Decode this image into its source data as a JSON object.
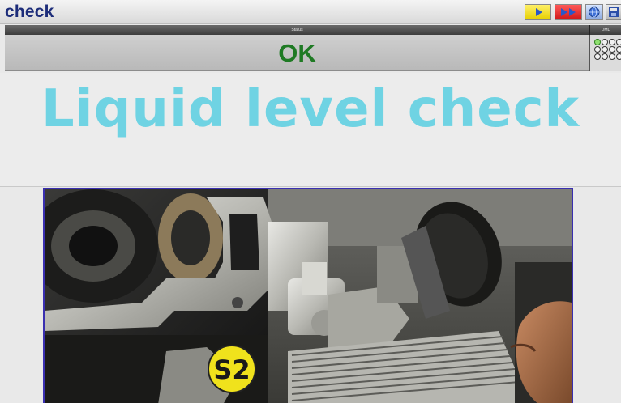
{
  "app": {
    "title": "check"
  },
  "toolbar": {
    "buttons": [
      {
        "name": "play",
        "icon": "play-icon",
        "color": "#e6cf00"
      },
      {
        "name": "fast-forward",
        "icon": "fast-forward-icon",
        "color": "#d01818"
      },
      {
        "name": "info",
        "icon": "globe-icon",
        "color": "#8aa8e0"
      },
      {
        "name": "save",
        "icon": "save-icon",
        "color": "#b8b8b8"
      }
    ]
  },
  "status": {
    "header_label": "Status",
    "side_label": "DML",
    "value": "OK",
    "value_color": "#1f7a24",
    "position_grid": {
      "rows": 3,
      "cols": 4,
      "active_index": 0
    }
  },
  "step": {
    "title": "Liquid level check",
    "title_color": "#6fd3e3"
  },
  "photo": {
    "subject": "engine-oil-cooler-photo",
    "marker_label": "S2",
    "marker_color": "#f0e21c"
  }
}
